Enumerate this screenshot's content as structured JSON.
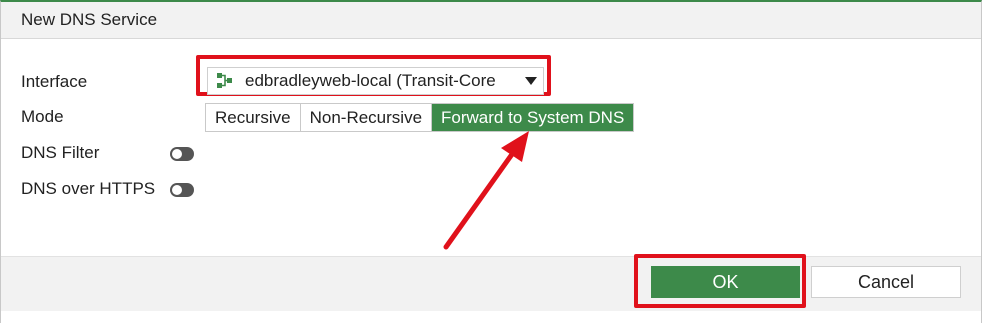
{
  "dialog": {
    "title": "New DNS Service"
  },
  "form": {
    "interface": {
      "label": "Interface",
      "value": "edbradleyweb-local (Transit-Core",
      "icon": "network-interface-icon"
    },
    "mode": {
      "label": "Mode",
      "options": [
        "Recursive",
        "Non-Recursive",
        "Forward to System DNS"
      ],
      "selected": "Forward to System DNS"
    },
    "dns_filter": {
      "label": "DNS Filter",
      "enabled": false
    },
    "dns_over_https": {
      "label": "DNS over HTTPS",
      "enabled": false
    }
  },
  "footer": {
    "ok_label": "OK",
    "cancel_label": "Cancel"
  },
  "colors": {
    "accent_green": "#3d8a4a",
    "annotation_red": "#e0111b"
  }
}
